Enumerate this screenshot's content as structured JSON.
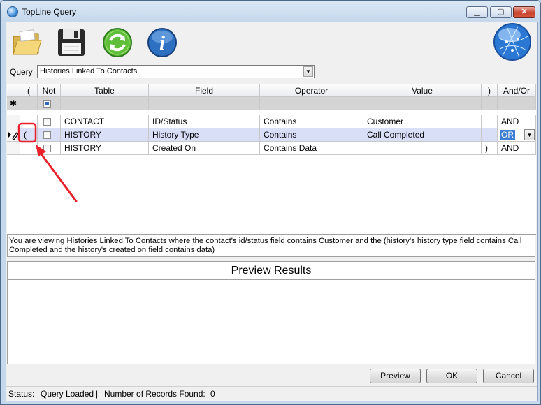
{
  "window": {
    "title": "TopLine Query"
  },
  "toolbar": {
    "open_icon": "folder-open-icon",
    "save_icon": "floppy-save-icon",
    "refresh_icon": "refresh-icon",
    "info_icon": "info-icon",
    "globe_icon": "globe-icon"
  },
  "query": {
    "label": "Query",
    "selected": "Histories Linked To Contacts"
  },
  "grid": {
    "columns": [
      "(",
      "Not",
      "Table",
      "Field",
      "Operator",
      "Value",
      ")",
      "And/Or"
    ],
    "new_row_marker": "✱",
    "current_row_marker": "▶",
    "rows": [
      {
        "open": "",
        "table": "CONTACT",
        "field": "ID/Status",
        "operator": "Contains",
        "value": "Customer",
        "close": "",
        "andor": "AND"
      },
      {
        "open": "(",
        "table": "HISTORY",
        "field": "History Type",
        "operator": "Contains",
        "value": "Call Completed",
        "close": "",
        "andor": "OR"
      },
      {
        "open": "",
        "table": "HISTORY",
        "field": "Created On",
        "operator": "Contains Data",
        "value": "",
        "close": ")",
        "andor": "AND"
      }
    ]
  },
  "description": "You are viewing Histories Linked To Contacts where the contact's id/status field contains Customer and the (history's history type field contains Call Completed and the history's created on field contains data)",
  "preview": {
    "title": "Preview Results"
  },
  "buttons": {
    "preview": "Preview",
    "ok": "OK",
    "cancel": "Cancel"
  },
  "status": {
    "label": "Status:",
    "value": "Query Loaded",
    "sep": "|",
    "records_label": "Number of Records Found:",
    "records_value": "0"
  },
  "colors": {
    "selected_row": "#d9dff7",
    "annotation": "#e8212b",
    "title_bar": "#c5d8ec"
  }
}
